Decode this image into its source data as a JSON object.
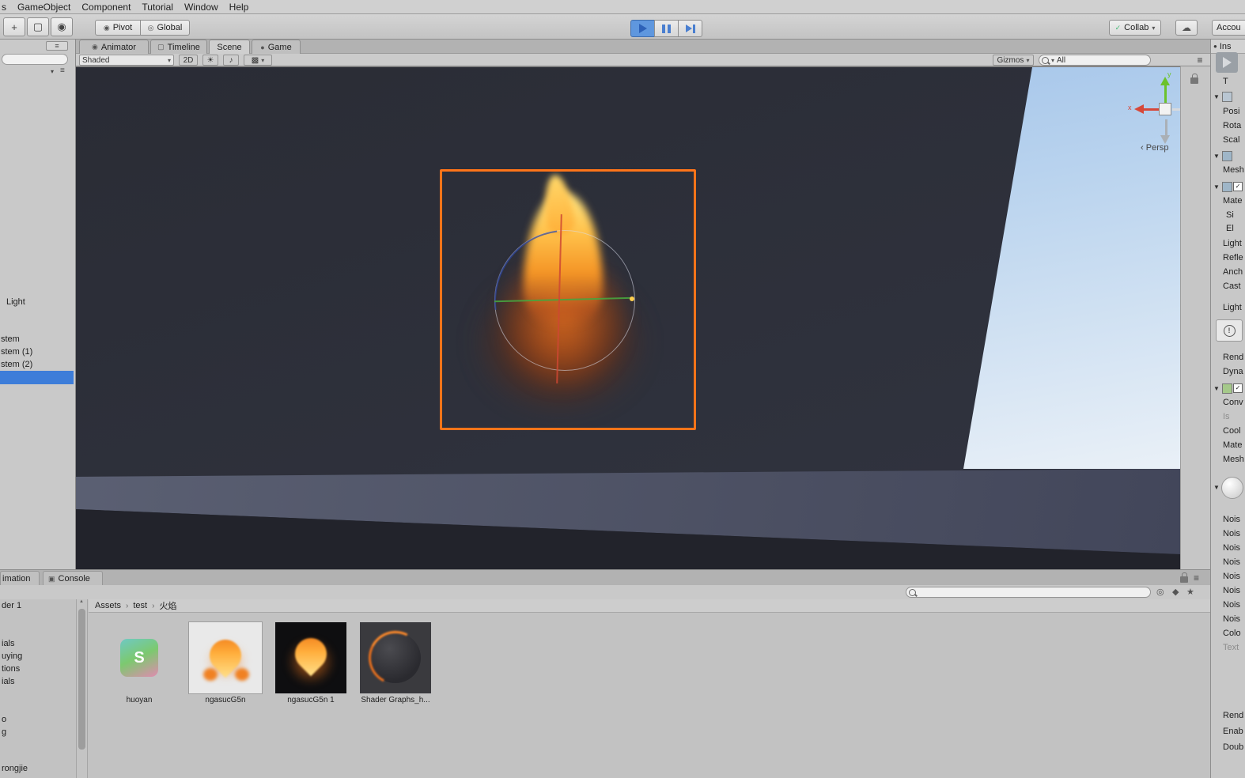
{
  "menubar": {
    "items": [
      "s",
      "GameObject",
      "Component",
      "Tutorial",
      "Window",
      "Help"
    ]
  },
  "toolbar": {
    "pivot_label": "Pivot",
    "global_label": "Global",
    "collab_label": "Collab",
    "account_label": "Accou"
  },
  "view_tabs": {
    "animator": "Animator",
    "timeline": "Timeline",
    "scene": "Scene",
    "game": "Game"
  },
  "scene_toolbar": {
    "shaded_label": "Shaded",
    "d2_label": "2D",
    "gizmos_label": "Gizmos",
    "search_value": "All"
  },
  "scene_view": {
    "persp_label": "Persp",
    "axis_x_label": "x",
    "axis_y_label": "y"
  },
  "hierarchy": {
    "items": [
      "Light",
      "stem",
      "stem (1)",
      "stem (2)"
    ]
  },
  "bottom_panel": {
    "tabs": {
      "animation": "imation",
      "console": "Console"
    },
    "breadcrumb": {
      "root": "Assets",
      "mid": "test",
      "leaf": "火焰"
    },
    "folders": [
      "der 1",
      "ials",
      "uying",
      "tions",
      "ials",
      "o",
      "g",
      "rongjie"
    ],
    "assets": [
      {
        "name": "huoyan",
        "letter": "S"
      },
      {
        "name": "ngasucG5n"
      },
      {
        "name": "ngasucG5n 1"
      },
      {
        "name": "Shader Graphs_h..."
      }
    ]
  },
  "inspector": {
    "tab_label": "Ins",
    "rows": [
      "T",
      "Posi",
      "Rota",
      "Scal",
      "Mesh",
      "Mate",
      "Si",
      "El",
      "Light",
      "Refle",
      "Anch",
      "Cast",
      "Light",
      "Rend",
      "Dyna",
      "Conv",
      "Is",
      "Cool",
      "Mate",
      "Mesh",
      "Nois",
      "Nois",
      "Nois",
      "Nois",
      "Nois",
      "Nois",
      "Nois",
      "Nois",
      "Colo",
      "Text",
      "Rend",
      "Enab",
      "Doub"
    ]
  },
  "icons": {
    "chevron_down": "▾",
    "chevron_left": "‹",
    "breadcrumb_separator": "›",
    "menu": "≡",
    "sun": "☀",
    "audio_note": "♪",
    "effects": "▩",
    "star": "★",
    "label_tag": "◆",
    "search_type": "◎",
    "check": "✓",
    "cloud": "☁",
    "console_window": "▣",
    "foldout": "▼",
    "warning_mark": "!",
    "inspector_dot": "●",
    "scroll_up": "▲",
    "move_tool": "+",
    "rect_tool": "▢",
    "transform_tool": "◉"
  },
  "colors": {
    "selection_blue": "#3d7dd9",
    "selection_gizmo_orange": "#ff7419",
    "play_active_blue": "#5f97de",
    "sky_top": "#93b9e6",
    "scene_wall": "#2c2e38"
  }
}
